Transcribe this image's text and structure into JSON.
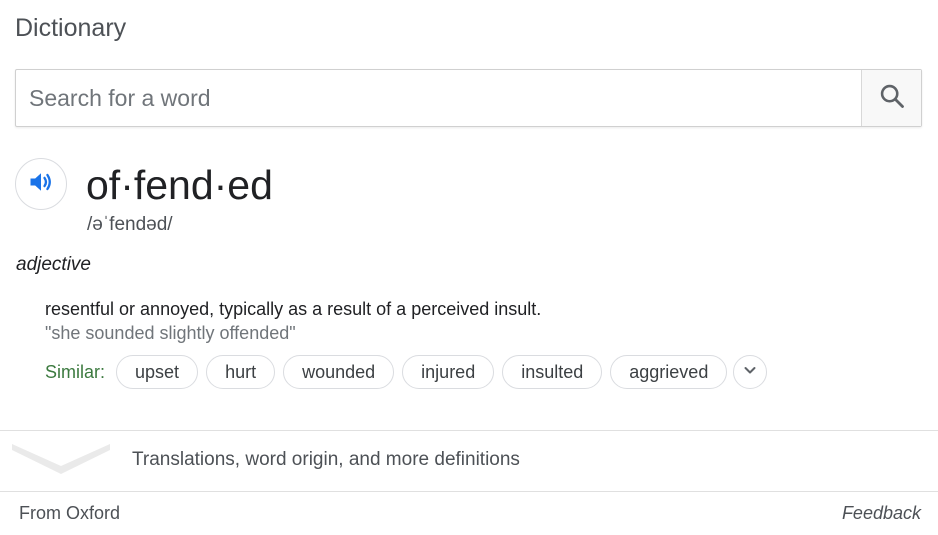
{
  "header": {
    "title": "Dictionary"
  },
  "search": {
    "placeholder": "Search for a word",
    "value": "",
    "button_icon": "search-icon"
  },
  "entry": {
    "audio_icon": "speaker-icon",
    "headword": "of·fend·ed",
    "phonetic": "/əˈfendəd/",
    "part_of_speech": "adjective",
    "definition": "resentful or annoyed, typically as a result of a perceived insult.",
    "example": "\"she sounded slightly offended\"",
    "similar_label": "Similar:",
    "similar": [
      {
        "label": "upset"
      },
      {
        "label": "hurt"
      },
      {
        "label": "wounded"
      },
      {
        "label": "injured"
      },
      {
        "label": "insulted"
      },
      {
        "label": "aggrieved"
      }
    ],
    "expand_icon": "chevron-down-icon"
  },
  "more": {
    "label": "Translations, word origin, and more definitions",
    "icon": "chevron-down-icon"
  },
  "footer": {
    "source": "From Oxford",
    "feedback": "Feedback"
  },
  "colors": {
    "accent_blue": "#1a73e8",
    "similar_green": "#3c7a3f",
    "chip_border": "#dadce0",
    "divider": "#e0e0e0"
  }
}
